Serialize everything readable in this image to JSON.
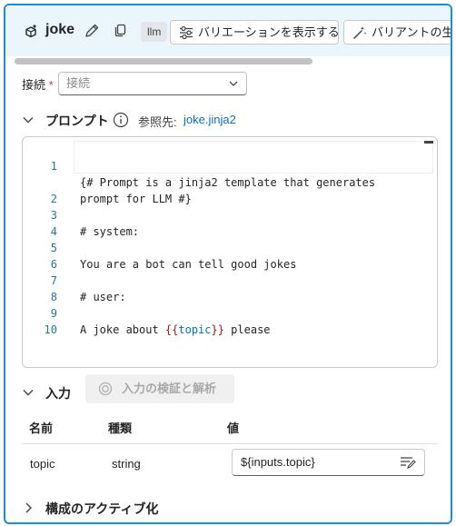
{
  "node": {
    "name": "joke",
    "type_badge": "llm",
    "show_variations_label": "バリエーションを表示する",
    "generate_variant_label": "バリアントの生成"
  },
  "connection": {
    "label": "接続",
    "required_mark": "*",
    "placeholder": "接続"
  },
  "prompt": {
    "section_label": "プロンプト",
    "reference_label": "参照先:",
    "reference_file": "joke.jinja2",
    "lines": [
      {
        "num": "1",
        "text": "{# Prompt is a jinja2 template that generates"
      },
      {
        "num": "",
        "text": "prompt for LLM #}"
      },
      {
        "num": "2",
        "text": ""
      },
      {
        "num": "3",
        "text": "# system:"
      },
      {
        "num": "4",
        "text": ""
      },
      {
        "num": "5",
        "text": "You are a bot can tell good jokes"
      },
      {
        "num": "6",
        "text": ""
      },
      {
        "num": "7",
        "text": "# user:"
      },
      {
        "num": "8",
        "text": ""
      },
      {
        "num": "9",
        "text": "A joke about "
      },
      {
        "num": "10",
        "text": ""
      }
    ],
    "template_open": "{{",
    "template_var": "topic",
    "template_close": "}}",
    "line9_suffix": " please"
  },
  "inputs": {
    "section_label": "入力",
    "verify_button_label": "入力の検証と解析",
    "columns": {
      "name": "名前",
      "type": "種類",
      "value": "値"
    },
    "rows": [
      {
        "name": "topic",
        "type": "string",
        "value": "${inputs.topic}"
      }
    ]
  },
  "activation": {
    "section_label": "構成のアクティブ化"
  },
  "colors": {
    "accent": "#1a8fd9",
    "header_bg": "#eaf5fc",
    "link": "#0f6cbd",
    "comment": "#008000",
    "template_brace": "#a31515",
    "template_var": "#0070c1"
  }
}
